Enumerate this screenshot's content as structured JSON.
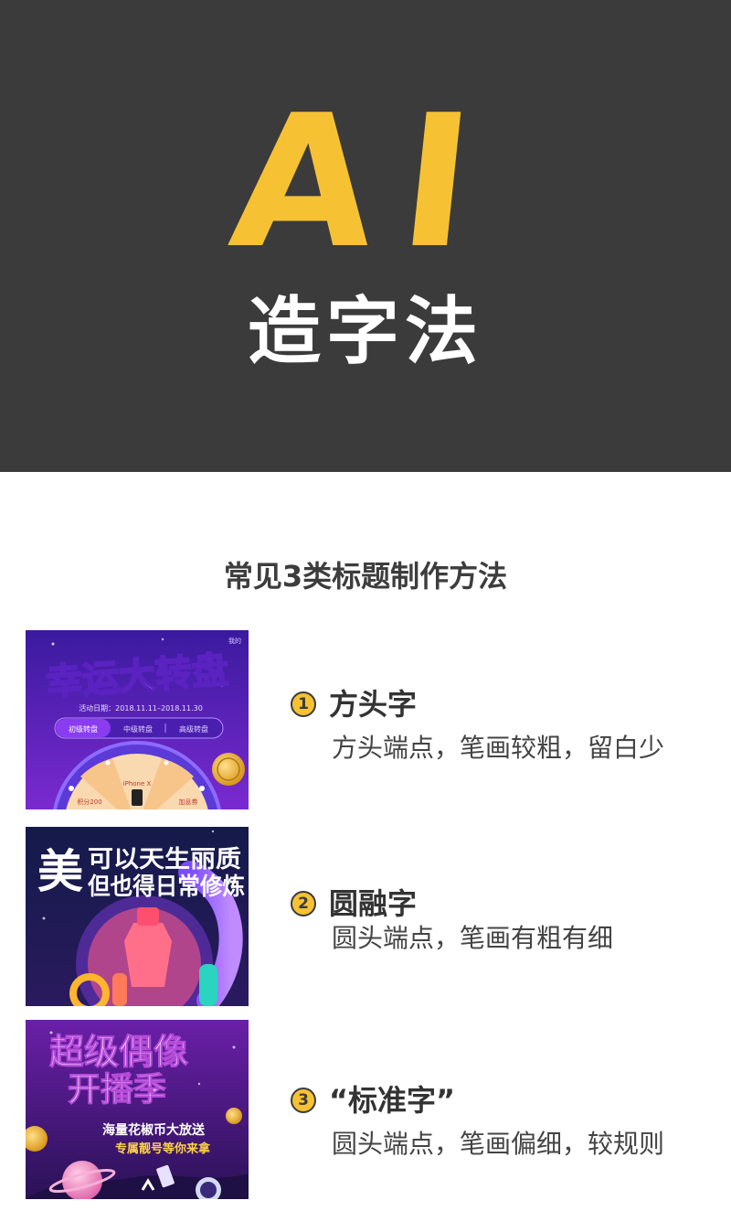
{
  "hero": {
    "title": "AI",
    "subtitle": "造字法"
  },
  "section_title": "常见3类标题制作方法",
  "thumbnails": [
    {
      "headline": "幸运大转盘",
      "date_line": "活动日期：2018.11.11–2018.11.30",
      "tabs": [
        "初级转盘",
        "中级转盘",
        "高级转盘"
      ],
      "wheel_labels": [
        "iPhone X",
        "积分200",
        "加息券"
      ],
      "corner_text": "我的"
    },
    {
      "headline_big": "美",
      "line1": "可以天生丽质",
      "line2": "但也得日常修炼"
    },
    {
      "line1": "超级偶像",
      "line2": "开播季",
      "line3": "海量花椒币大放送",
      "line4": "专属靓号等你来拿"
    }
  ],
  "methods": [
    {
      "number": "1",
      "title": "方头字",
      "description": "方头端点，笔画较粗，留白少"
    },
    {
      "number": "2",
      "title": "圆融字",
      "description": "圆头端点，笔画有粗有细"
    },
    {
      "number": "3",
      "title": "“标准字”",
      "description": "圆头端点，笔画偏细，较规则"
    }
  ],
  "colors": {
    "hero_bg": "#3b3b3b",
    "accent_yellow": "#f6c234",
    "text_dark": "#333333"
  }
}
